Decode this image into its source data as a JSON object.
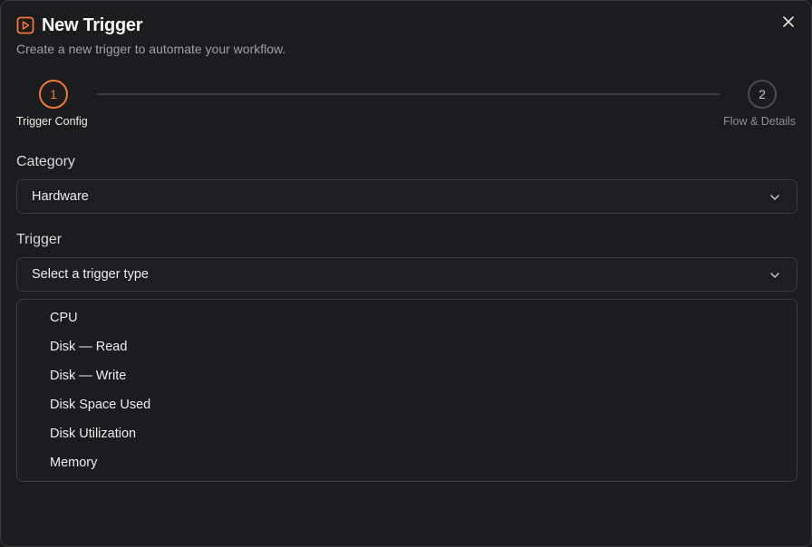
{
  "dialog": {
    "icon": "play-square-icon",
    "title": "New Trigger",
    "subtitle": "Create a new trigger to automate your workflow.",
    "close_icon": "close-icon",
    "accent_color": "#f07a35"
  },
  "stepper": {
    "steps": [
      {
        "number": "1",
        "label": "Trigger Config",
        "active": true
      },
      {
        "number": "2",
        "label": "Flow & Details",
        "active": false
      }
    ]
  },
  "form": {
    "category": {
      "label": "Category",
      "value": "Hardware"
    },
    "trigger": {
      "label": "Trigger",
      "placeholder": "Select a trigger type",
      "options": [
        "CPU",
        "Disk — Read",
        "Disk — Write",
        "Disk Space Used",
        "Disk Utilization",
        "Memory"
      ]
    }
  }
}
